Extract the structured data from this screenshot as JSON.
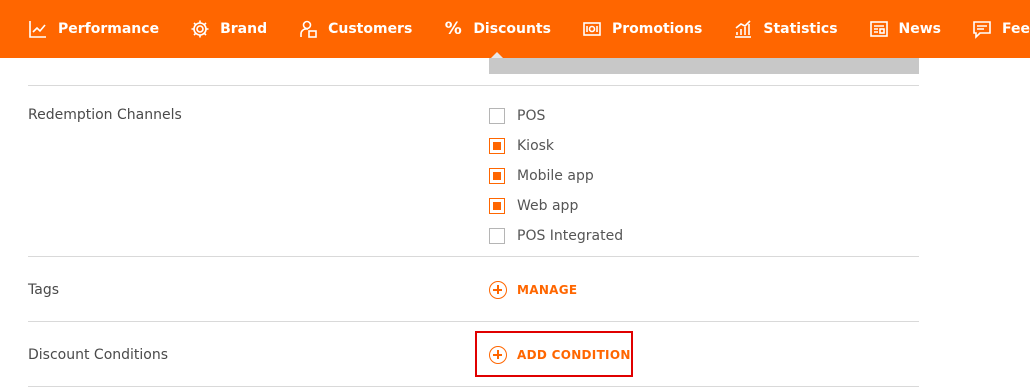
{
  "nav": {
    "items": [
      {
        "label": "Performance",
        "icon": "chart-line-icon"
      },
      {
        "label": "Brand",
        "icon": "gear-icon"
      },
      {
        "label": "Customers",
        "icon": "customer-icon"
      },
      {
        "label": "Discounts",
        "icon": "percent-icon",
        "symbol": "%",
        "active": true
      },
      {
        "label": "Promotions",
        "icon": "promotion-icon"
      },
      {
        "label": "Statistics",
        "icon": "bar-chart-icon"
      },
      {
        "label": "News",
        "icon": "newspaper-icon"
      },
      {
        "label": "Feedback",
        "icon": "speech-bubble-icon"
      }
    ]
  },
  "redemption": {
    "label": "Redemption Channels",
    "options": [
      {
        "label": "POS",
        "checked": false
      },
      {
        "label": "Kiosk",
        "checked": true
      },
      {
        "label": "Mobile app",
        "checked": true
      },
      {
        "label": "Web app",
        "checked": true
      },
      {
        "label": "POS Integrated",
        "checked": false
      }
    ]
  },
  "tags": {
    "label": "Tags",
    "action": "MANAGE"
  },
  "conditions": {
    "label": "Discount Conditions",
    "action": "ADD CONDITION"
  },
  "colors": {
    "brand": "#ff6600",
    "highlight": "#e00000"
  }
}
